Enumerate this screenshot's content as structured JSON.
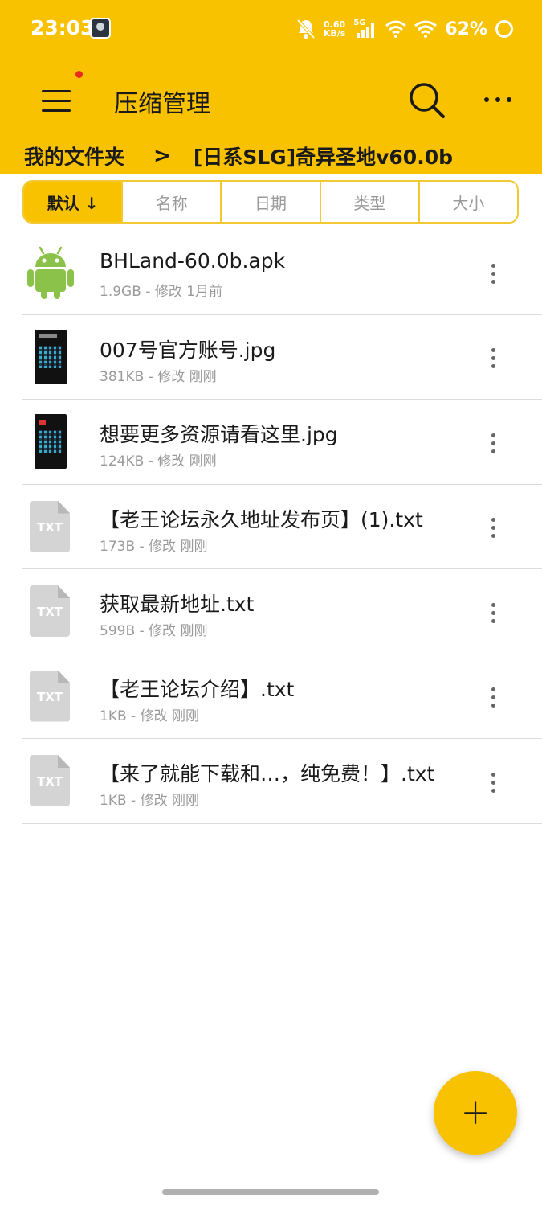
{
  "status_bar": {
    "time": "23:03",
    "net_speed_value": "0.60",
    "net_speed_unit": "KB/s",
    "network_type": "5G",
    "battery": "62%"
  },
  "toolbar": {
    "title": "压缩管理",
    "menu_icon": "hamburger-menu-icon",
    "search_icon": "search-icon",
    "more_icon": "more-horizontal-icon"
  },
  "breadcrumb": {
    "root": "我的文件夹",
    "separator": ">",
    "current": "[日系SLG]奇异圣地v60.0b"
  },
  "sort_tabs": [
    {
      "label": "默认 ↓",
      "active": true
    },
    {
      "label": "名称",
      "active": false
    },
    {
      "label": "日期",
      "active": false
    },
    {
      "label": "类型",
      "active": false
    },
    {
      "label": "大小",
      "active": false
    }
  ],
  "files": [
    {
      "name": "BHLand-60.0b.apk",
      "meta": "1.9GB - 修改 1月前",
      "icon": "android-icon"
    },
    {
      "name": "007号官方账号.jpg",
      "meta": "381KB - 修改 刚刚",
      "icon": "image-thumbnail"
    },
    {
      "name": "想要更多资源请看这里.jpg",
      "meta": "124KB - 修改 刚刚",
      "icon": "image-thumbnail"
    },
    {
      "name": "【老王论坛永久地址发布页】(1).txt",
      "meta": "173B - 修改 刚刚",
      "icon": "txt-file-icon",
      "icon_label": "TXT"
    },
    {
      "name": "获取最新地址.txt",
      "meta": "599B - 修改 刚刚",
      "icon": "txt-file-icon",
      "icon_label": "TXT"
    },
    {
      "name": "【老王论坛介绍】.txt",
      "meta": "1KB - 修改 刚刚",
      "icon": "txt-file-icon",
      "icon_label": "TXT"
    },
    {
      "name": "【来了就能下载和…，纯免费！】.txt",
      "meta": "1KB - 修改 刚刚",
      "icon": "txt-file-icon",
      "icon_label": "TXT"
    }
  ],
  "fab": {
    "label": "+",
    "icon": "add-icon"
  },
  "colors": {
    "accent": "#f8c200",
    "text": "#1a1a1a",
    "muted": "#9a9a9a",
    "android_green": "#8bc34a"
  }
}
